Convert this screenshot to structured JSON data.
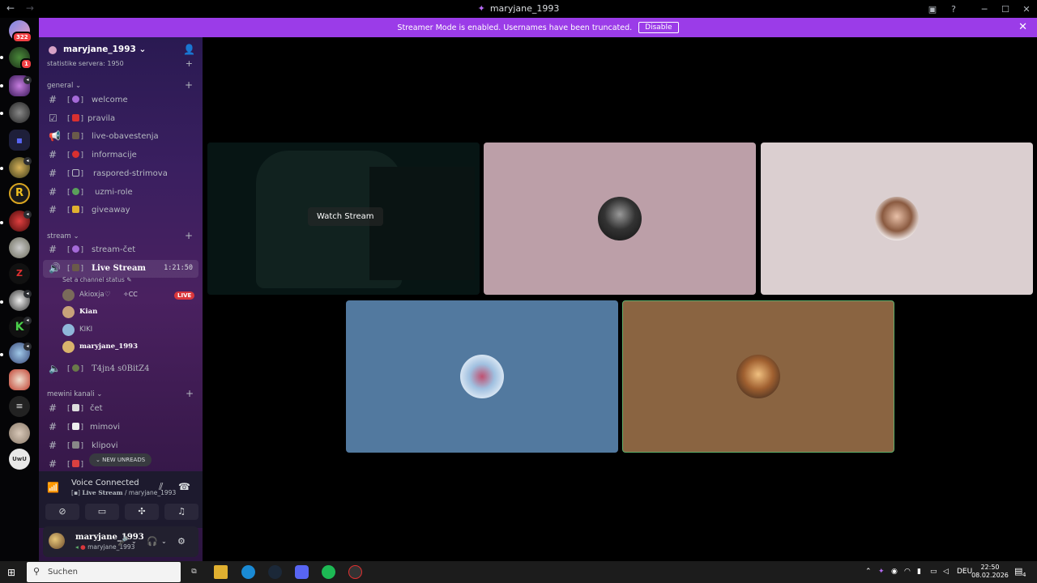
{
  "window": {
    "title": "maryjane_1993",
    "back_glyph": "←",
    "fwd_glyph": "→",
    "title_icon": "discord-glyph-icon"
  },
  "banner": {
    "text": "Streamer Mode is enabled. Usernames have been truncated.",
    "button": "Disable"
  },
  "rail": {
    "home_badge": "322",
    "server_badge": "1",
    "folder_glyph": "▪"
  },
  "server": {
    "name": "maryjane_1993",
    "cut_category": "statistike servera: 1950"
  },
  "categories": {
    "general": "general",
    "stream": "stream",
    "mewini": "mewini kanali"
  },
  "channels": {
    "welcome": "welcome",
    "pravila": "pravila",
    "live_obavestenja": "live-obavestenja",
    "informacije": "informacije",
    "raspored": "raspored-strimova",
    "uzmi_role": "uzmi-role",
    "giveaway": "giveaway",
    "stream_cet": "stream-čet",
    "live_stream": "Live Stream",
    "live_timer": "1:21:50",
    "channel_status": "Set a channel status",
    "t4jn4": "T4jn4 s0BitZ4",
    "cet": "čet",
    "mimovi": "mimovi",
    "klipovi": "klipovi"
  },
  "voice_users": [
    {
      "name": "Akioxja",
      "extra": "✧CC",
      "badge": "LIVE",
      "color": "#7a6b5a"
    },
    {
      "name": "Kian",
      "color": "#c8a27a"
    },
    {
      "name": "KIKI",
      "color": "#8fb7d9"
    },
    {
      "name": "maryjane_1993",
      "color": "#d9b36c"
    }
  ],
  "new_unreads": "NEW UNREADS",
  "voice": {
    "status": "Voice Connected",
    "channel": "Live Stream",
    "separator": " / ",
    "server": "maryjane_1993"
  },
  "user": {
    "name": "maryjane_1993",
    "status": "maryjane_1993"
  },
  "stage": {
    "watch_label": "Watch Stream",
    "tiles": [
      {
        "id": "stream",
        "bg": "#0e2726"
      },
      {
        "id": "user-2",
        "bg": "#bc9fa8"
      },
      {
        "id": "user-3",
        "bg": "#dbcfd0"
      },
      {
        "id": "user-4",
        "bg": "#52799f"
      },
      {
        "id": "user-5",
        "bg": "#8a6441",
        "speaking": true
      }
    ]
  },
  "taskbar": {
    "search_placeholder": "Suchen",
    "lang": "DEU",
    "time": "22:50",
    "date": "08.02.2026",
    "notif_count": "4"
  },
  "colors": {
    "accent": "#9b3ce8",
    "live": "#da373c",
    "speaking": "#5fae6a"
  }
}
